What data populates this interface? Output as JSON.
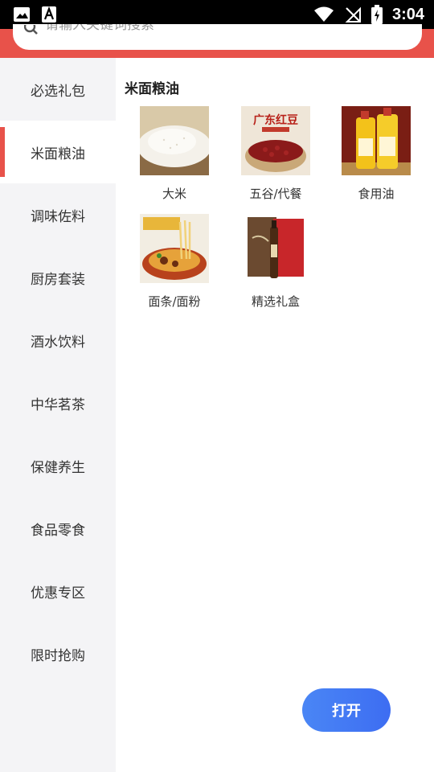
{
  "status_bar": {
    "time": "3:04",
    "icons": [
      "image-icon",
      "font-icon",
      "wifi-icon",
      "no-sim-icon",
      "battery-charging-icon"
    ]
  },
  "search": {
    "placeholder": "请输入关键词搜索",
    "icon": "search-icon"
  },
  "colors": {
    "header": "#e8524a",
    "accent": "#e8524a",
    "sidebar_bg": "#f4f4f6",
    "button": "#3d6df2"
  },
  "sidebar": {
    "items": [
      {
        "label": "必选礼包"
      },
      {
        "label": "米面粮油",
        "active": true
      },
      {
        "label": "调味佐料"
      },
      {
        "label": "厨房套装"
      },
      {
        "label": "酒水饮料"
      },
      {
        "label": "中华茗茶"
      },
      {
        "label": "保健养生"
      },
      {
        "label": "食品零食"
      },
      {
        "label": "优惠专区"
      },
      {
        "label": "限时抢购"
      }
    ]
  },
  "main": {
    "category_title": "米面粮油",
    "products": [
      {
        "label": "大米",
        "image": "rice-image"
      },
      {
        "label": "五谷/代餐",
        "image": "red-beans-image",
        "image_text": "广东红豆"
      },
      {
        "label": "食用油",
        "image": "cooking-oil-image"
      },
      {
        "label": "面条/面粉",
        "image": "noodles-image"
      },
      {
        "label": "精选礼盒",
        "image": "gift-box-image"
      }
    ]
  },
  "open_button": {
    "label": "打开"
  }
}
